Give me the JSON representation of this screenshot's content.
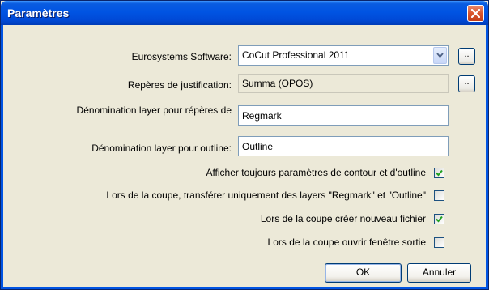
{
  "window": {
    "title": "Paramètres",
    "accent_color": "#0054e3",
    "close_icon": "close-icon"
  },
  "form": {
    "software_label": "Eurosystems Software:",
    "software_value": "CoCut Professional 2011",
    "reperes_label": "Repères de justification:",
    "reperes_value": "Summa (OPOS)",
    "denom_reperes_label": "Dénomination layer pour répères de",
    "denom_reperes_value": "Regmark",
    "denom_outline_label": "Dénomination layer pour outline:",
    "denom_outline_value": "Outline",
    "browse_label": ".."
  },
  "options": [
    {
      "label": "Afficher toujours paramètres de contour et d'outline",
      "checked": true
    },
    {
      "label": "Lors de la coupe, transférer uniquement des layers \"Regmark\" et \"Outline\"",
      "checked": false
    },
    {
      "label": "Lors de la coupe créer nouveau fichier",
      "checked": true
    },
    {
      "label": "Lors de la coupe ouvrir fenêtre sortie",
      "checked": false
    }
  ],
  "buttons": {
    "ok_label": "OK",
    "cancel_label": "Annuler"
  }
}
